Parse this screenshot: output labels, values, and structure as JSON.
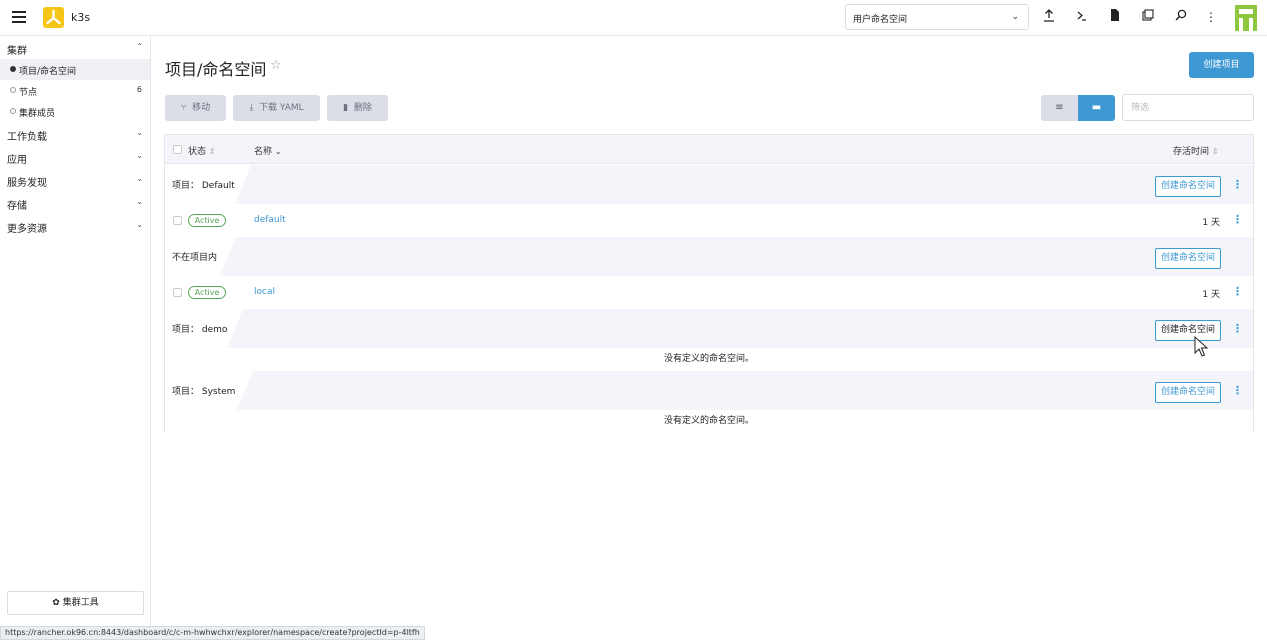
{
  "header": {
    "brand": "k3s",
    "namespace_select": "用户命名空间",
    "icons": [
      "upload-icon",
      "terminal-icon",
      "file-icon",
      "copy-icon",
      "search-icon",
      "more-vert-icon"
    ]
  },
  "sidebar": {
    "groups": [
      {
        "label": "集群",
        "expanded": true
      },
      {
        "label": "工作负载"
      },
      {
        "label": "应用"
      },
      {
        "label": "服务发现"
      },
      {
        "label": "存储"
      },
      {
        "label": "更多资源"
      }
    ],
    "items": [
      {
        "label": "项目/命名空间",
        "active": true
      },
      {
        "label": "节点",
        "count": "6"
      },
      {
        "label": "集群成员"
      }
    ],
    "cluster_tools": "集群工具"
  },
  "page": {
    "title": "项目/命名空间",
    "create_project": "创建项目",
    "toolbar": {
      "move": "移动",
      "download_yaml": "下载 YAML",
      "delete": "删除"
    },
    "filter_placeholder": "筛选"
  },
  "table": {
    "columns": {
      "state": "状态",
      "name": "名称",
      "age": "存活时间"
    },
    "create_ns_label": "创建命名空间",
    "groups": [
      {
        "label": "项目： Default",
        "rows": [
          {
            "state": "Active",
            "name": "default",
            "age": "1 天"
          }
        ]
      },
      {
        "label": "不在项目内",
        "rows": [
          {
            "state": "Active",
            "name": "local",
            "age": "1 天"
          }
        ]
      },
      {
        "label": "项目： demo",
        "empty": "没有定义的命名空间。"
      },
      {
        "label": "项目： System",
        "empty": "没有定义的命名空间。"
      }
    ]
  },
  "statusbar": {
    "url": "https://rancher.ok96.cn:8443/dashboard/c/c-m-hwhwchxr/explorer/namespace/create?projectId=p-4ltfh"
  },
  "colors": {
    "primary": "#3d98d3",
    "active_badge": "#5ba55b",
    "avatar": "#8dc63f",
    "logo": "#f5c518"
  }
}
